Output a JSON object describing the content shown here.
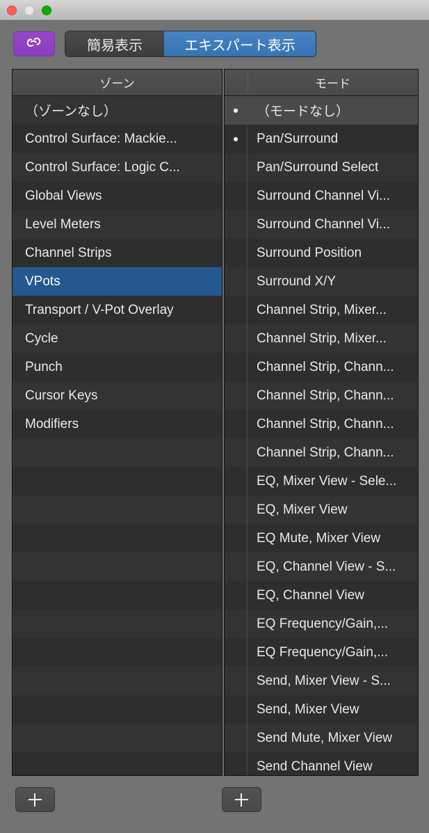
{
  "window": {
    "controls": [
      {
        "name": "close",
        "color": "#ff5f57"
      },
      {
        "name": "minimize",
        "color": "#e8e8e8"
      },
      {
        "name": "maximize",
        "color": "#0fad00"
      }
    ]
  },
  "toolbar": {
    "link_icon": "link-icon",
    "link_button_color": "#8f41c5",
    "segments": [
      {
        "label": "簡易表示",
        "selected": false
      },
      {
        "label": "エキスパート表示",
        "selected": true
      }
    ],
    "accent_color": "#3573b4"
  },
  "zone_panel": {
    "header": "ゾーン",
    "add_button_label": "+",
    "items": [
      {
        "label": "（ゾーンなし）",
        "selected": false
      },
      {
        "label": "Control Surface: Mackie...",
        "selected": false
      },
      {
        "label": "Control Surface: Logic C...",
        "selected": false
      },
      {
        "label": "Global Views",
        "selected": false
      },
      {
        "label": "Level Meters",
        "selected": false
      },
      {
        "label": "Channel Strips",
        "selected": false
      },
      {
        "label": "VPots",
        "selected": true
      },
      {
        "label": "Transport / V-Pot Overlay",
        "selected": false
      },
      {
        "label": "Cycle",
        "selected": false
      },
      {
        "label": "Punch",
        "selected": false
      },
      {
        "label": "Cursor Keys",
        "selected": false
      },
      {
        "label": "Modifiers",
        "selected": false
      }
    ],
    "selection_color": "#24588f"
  },
  "mode_panel": {
    "header": "モード",
    "add_button_label": "+",
    "items": [
      {
        "label": "（モードなし）",
        "dot": true,
        "highlight": true
      },
      {
        "label": "Pan/Surround",
        "dot": true,
        "highlight": false
      },
      {
        "label": "Pan/Surround Select",
        "dot": false,
        "highlight": false
      },
      {
        "label": "Surround Channel Vi...",
        "dot": false,
        "highlight": false
      },
      {
        "label": "Surround Channel Vi...",
        "dot": false,
        "highlight": false
      },
      {
        "label": "Surround Position",
        "dot": false,
        "highlight": false
      },
      {
        "label": "Surround X/Y",
        "dot": false,
        "highlight": false
      },
      {
        "label": "Channel Strip, Mixer...",
        "dot": false,
        "highlight": false
      },
      {
        "label": "Channel Strip, Mixer...",
        "dot": false,
        "highlight": false
      },
      {
        "label": "Channel Strip, Chann...",
        "dot": false,
        "highlight": false
      },
      {
        "label": "Channel Strip, Chann...",
        "dot": false,
        "highlight": false
      },
      {
        "label": "Channel Strip, Chann...",
        "dot": false,
        "highlight": false
      },
      {
        "label": "Channel Strip, Chann...",
        "dot": false,
        "highlight": false
      },
      {
        "label": "EQ, Mixer View - Sele...",
        "dot": false,
        "highlight": false
      },
      {
        "label": "EQ, Mixer View",
        "dot": false,
        "highlight": false
      },
      {
        "label": "EQ Mute, Mixer View",
        "dot": false,
        "highlight": false
      },
      {
        "label": "EQ, Channel View - S...",
        "dot": false,
        "highlight": false
      },
      {
        "label": "EQ, Channel View",
        "dot": false,
        "highlight": false
      },
      {
        "label": "EQ Frequency/Gain,...",
        "dot": false,
        "highlight": false
      },
      {
        "label": "EQ Frequency/Gain,...",
        "dot": false,
        "highlight": false
      },
      {
        "label": "Send, Mixer View - S...",
        "dot": false,
        "highlight": false
      },
      {
        "label": "Send, Mixer View",
        "dot": false,
        "highlight": false
      },
      {
        "label": "Send Mute, Mixer View",
        "dot": false,
        "highlight": false
      },
      {
        "label": "Send Channel View",
        "dot": false,
        "highlight": false
      }
    ]
  }
}
